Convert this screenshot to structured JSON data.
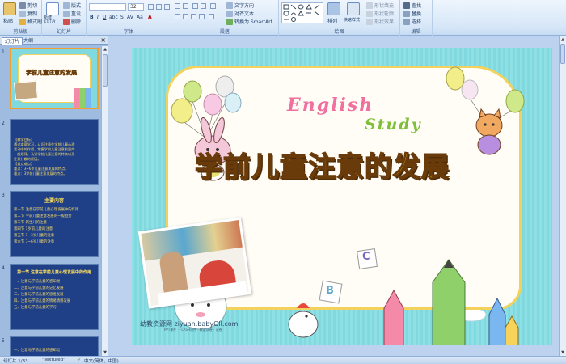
{
  "ribbon": {
    "clipboard": {
      "paste": "粘贴",
      "cut": "剪切",
      "copy": "复制",
      "format_painter": "格式刷",
      "label": "剪贴板"
    },
    "slides": {
      "new_slide": "新建\n幻灯片",
      "layout": "版式",
      "reset": "重设",
      "delete": "删除",
      "label": "幻灯片"
    },
    "font": {
      "font_name": "",
      "font_size": "32",
      "label": "字体"
    },
    "paragraph": {
      "text_direction": "文字方向",
      "align_text": "对齐文本",
      "smartart": "转换为 SmartArt",
      "label": "段落"
    },
    "drawing": {
      "arrange": "排列",
      "quick_styles": "快速样式",
      "shape_fill": "形状填充",
      "shape_outline": "形状轮廓",
      "shape_effects": "形状效果",
      "label": "绘图"
    },
    "editing": {
      "find": "查找",
      "replace": "替换",
      "select": "选择",
      "label": "编辑"
    }
  },
  "panel": {
    "tabs": [
      "幻灯片",
      "大纲"
    ],
    "close": "×",
    "slide_numbers": [
      "1",
      "2",
      "3",
      "4",
      "5"
    ],
    "slide2_lines": [
      "【教学目标】",
      "通过本章学习，认识注意在学前儿童心理",
      "活动中的作用，掌握学前儿童注意发展的",
      "一般规律，认识学前儿童注意的特点以及",
      "注意分散的原因。",
      "【重点难点】",
      "重点：3~6岁儿童注意发展的特点。",
      "难点：3岁前儿童注意发展的特点。"
    ],
    "slide3_title": "主要内容",
    "slide3_lines": [
      "第一节  注意在学前儿童心理发展中的作用",
      "第二节  学前儿童注意发展的一般趋势",
      "第三节  新生儿的注意",
      "第四节  1岁前儿童的注意",
      "第五节  1~3岁儿童的注意",
      "第六节  3~6岁儿童的注意"
    ],
    "slide4_title": "第一节  注意在学前儿童心理发展中的作用",
    "slide4_lines": [
      "一、注意与学前儿童的感知觉",
      "二、注意与学前儿童的记忆发展",
      "三、注意与学前儿童的思维发展",
      "四、注意与学前儿童的情绪情感发展",
      "五、注意与学前儿童的学习"
    ],
    "slide5_line": "一、注意与学前儿童的感知觉"
  },
  "slide": {
    "english": "English",
    "study": "Study",
    "title": "学前儿童注意的发展",
    "watermark": "幼教资源网 ziyuan.babyOll.com",
    "watermark_small": "PPT课件 · FLASH课件 · 教案试卷 · 试卷",
    "letter_c": "C",
    "letter_b": "B"
  },
  "status": {
    "slide_info": "幻灯片 1/33",
    "theme": "\"Textured\"",
    "language": "中文(简体，中国)"
  },
  "colors": {
    "slide_bg": "#7fd9df",
    "title_fill": "#ffd200",
    "ribbon": "#d6e6f8"
  }
}
